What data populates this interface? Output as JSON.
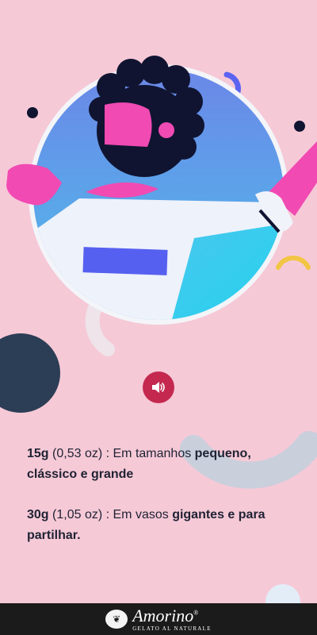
{
  "illustration": {
    "name": "person-avatar-illustration"
  },
  "controls": {
    "sound_icon": "volume-icon"
  },
  "info": {
    "line1": {
      "weight": "15g",
      "oz": " (0,53 oz) : Em tamanhos ",
      "highlight": "pequeno, clássico e grande"
    },
    "line2": {
      "weight": "30g",
      "oz": " (1,05 oz) : Em vasos ",
      "highlight": "gigantes e para partilhar."
    }
  },
  "footer": {
    "brand": "Amorino",
    "tagline": "GELATO AL NATURALE",
    "trademark": "®"
  },
  "colors": {
    "background": "#f6c9d7",
    "accent": "#c4284f",
    "footer": "#1b1b1b"
  }
}
